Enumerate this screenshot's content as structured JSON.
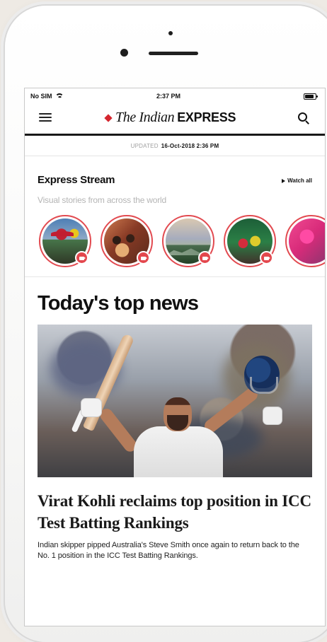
{
  "status_bar": {
    "carrier": "No SIM",
    "time": "2:37 PM"
  },
  "header": {
    "logo_script": "The Indian",
    "logo_bold": "EXPRESS",
    "menu_icon": "menu-icon",
    "search_icon": "search-icon"
  },
  "update_info": {
    "label": "UPDATED",
    "time": "16-Oct-2018 2:36 PM"
  },
  "express_stream": {
    "title": "Express Stream",
    "watch_all": "Watch all",
    "subtitle": "Visual stories from across the world",
    "stories": [
      {
        "icon": "video-icon"
      },
      {
        "icon": "video-icon"
      },
      {
        "icon": "video-icon"
      },
      {
        "icon": "video-icon"
      },
      {
        "icon": "video-icon"
      }
    ]
  },
  "top_news": {
    "title": "Today's top news",
    "article": {
      "headline": "Virat Kohli reclaims top position in ICC Test Batting Rankings",
      "summary": "Indian skipper pipped Australia's Steve Smith once again to return back to the No. 1 position in the ICC Test Batting Rankings."
    }
  },
  "colors": {
    "brand_red": "#d4262e",
    "story_ring": "#e24a50",
    "text_primary": "#111111"
  }
}
